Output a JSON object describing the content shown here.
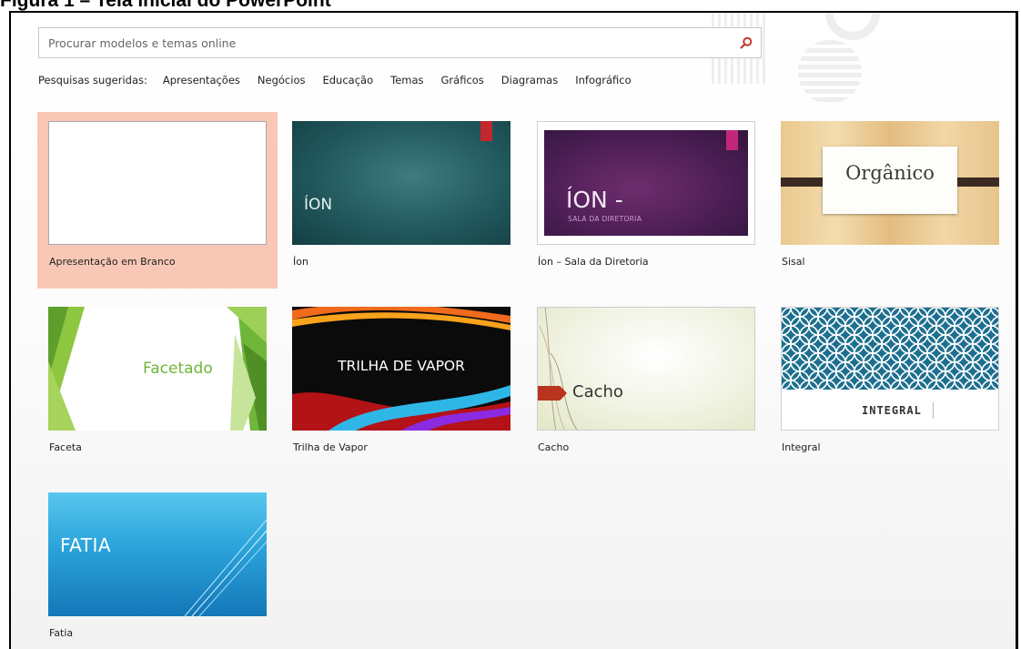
{
  "caption": "Figura 1 – Tela inicial do PowerPoint",
  "search": {
    "placeholder": "Procurar modelos e temas online",
    "value": "",
    "icon": "search-icon",
    "accent_color": "#c0392b"
  },
  "suggestions": {
    "label": "Pesquisas sugeridas:",
    "links": [
      "Apresentações",
      "Negócios",
      "Educação",
      "Temas",
      "Gráficos",
      "Diagramas",
      "Infográfico"
    ]
  },
  "templates": [
    {
      "label": "Apresentação em Branco",
      "selected": true
    },
    {
      "label": "Íon",
      "title": "ÍON"
    },
    {
      "label": "Íon – Sala da Diretoria",
      "title": "ÍON -",
      "subtitle": "SALA DA DIRETORIA"
    },
    {
      "label": "Sisal",
      "title": "Orgânico"
    },
    {
      "label": "Faceta",
      "title": "Facetado"
    },
    {
      "label": "Trilha de Vapor",
      "title": "TRILHA DE VAPOR"
    },
    {
      "label": "Cacho",
      "title": "Cacho"
    },
    {
      "label": "Integral",
      "title": "INTEGRAL"
    },
    {
      "label": "Fatia",
      "title": "FATIA"
    }
  ],
  "colors": {
    "selection": "#f9c7b6",
    "ion": "#21595d",
    "ion_boardroom": "#4e1f57",
    "faceta_green": "#6fb63a",
    "integral_blue": "#1d6f8e",
    "fatia_blue": "#2aa3da"
  }
}
